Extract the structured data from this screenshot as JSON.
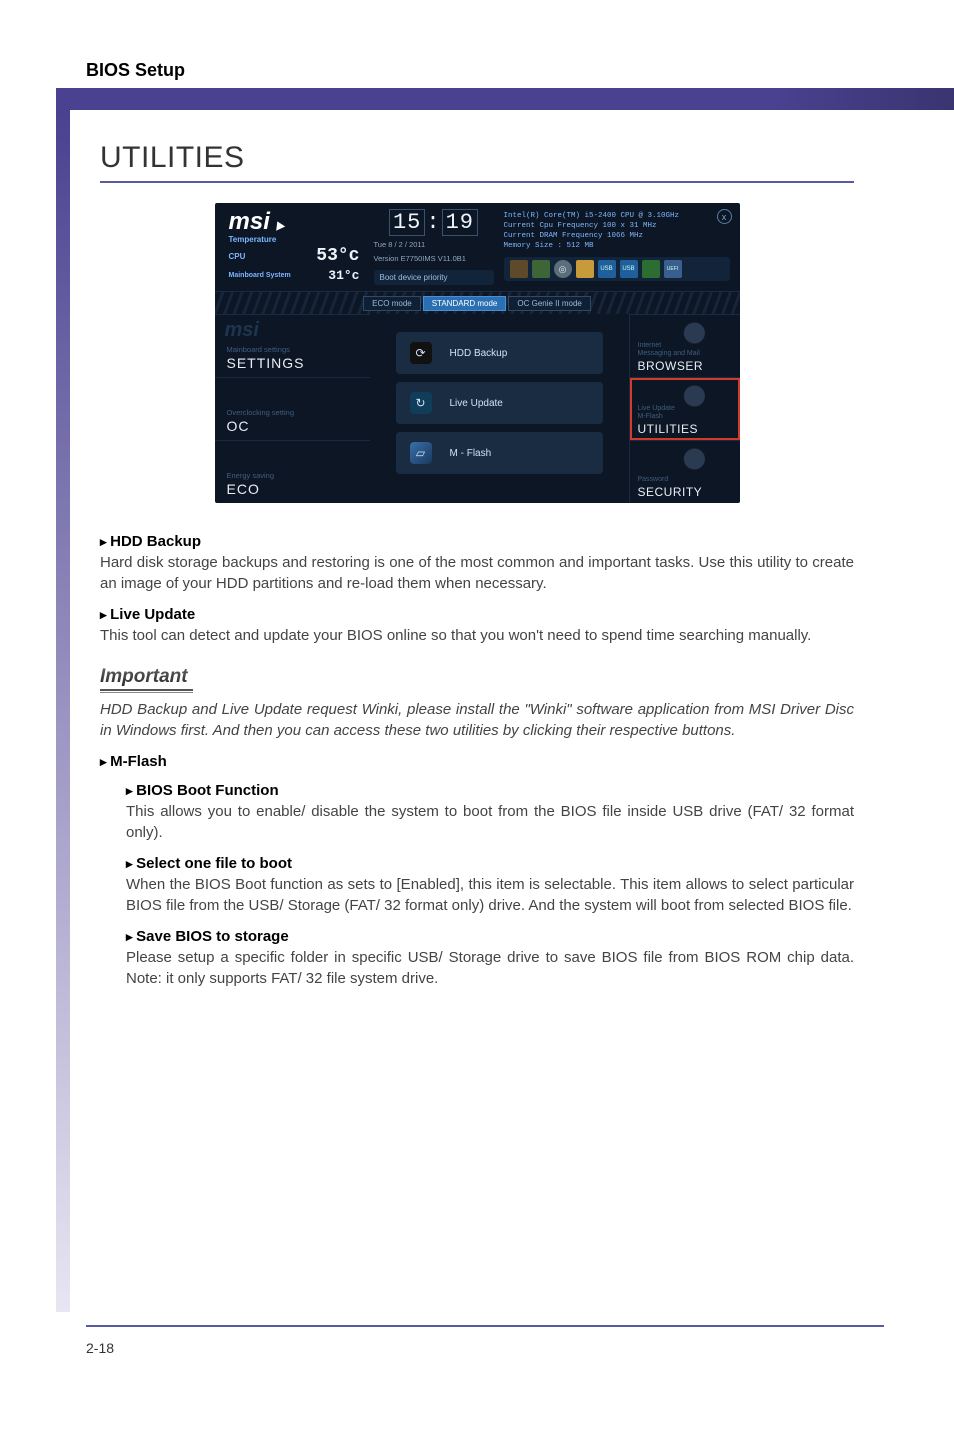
{
  "header": {
    "section_title": "BIOS Setup"
  },
  "page_title": "UTILITIES",
  "screenshot": {
    "brand": "msi",
    "temperature_label": "Temperature",
    "cpu_label": "CPU",
    "cpu_temp": "53°c",
    "mb_label": "Mainboard System",
    "mb_temp": "31°c",
    "clock": {
      "hh": "15",
      "mm": "19"
    },
    "date_line": "Tue  8 / 2 / 2011",
    "version_line": "Version E7750IMS V11.0B1",
    "boot_label": "Boot device priority",
    "cpu_info_1": "Intel(R) Core(TM) i5-2400 CPU @ 3.10GHz",
    "cpu_info_2": "Current Cpu Frequency 100 x 31 MHz",
    "cpu_info_3": "Current DRAM Frequency 1066 MHz",
    "cpu_info_4": "Memory Size : 512 MB",
    "modes": {
      "eco": "ECO\nmode",
      "standard": "STANDARD\nmode",
      "ocgenie": "OC Genie II\nmode"
    },
    "left_tiles": [
      {
        "ghost": "msi",
        "sub": "Mainboard settings",
        "main": "SETTINGS"
      },
      {
        "ghost": "",
        "sub": "Overclocking setting",
        "main": "OC"
      },
      {
        "ghost": "",
        "sub": "Energy saving",
        "main": "ECO"
      }
    ],
    "center_items": [
      {
        "label": "HDD Backup"
      },
      {
        "label": "Live Update"
      },
      {
        "label": "M - Flash"
      }
    ],
    "right_tiles": [
      {
        "sub": "Internet\nMessaging and Mail",
        "main": "BROWSER",
        "highlight": false
      },
      {
        "sub": "Live Update\nM-Flash",
        "main": "UTILITIES",
        "highlight": true
      },
      {
        "sub": "Password",
        "main": "SECURITY",
        "highlight": false
      }
    ]
  },
  "sections": {
    "hdd_backup": {
      "title": "HDD Backup",
      "text": "Hard disk storage backups and restoring is one of the most common and important tasks. Use this utility to create an image of your HDD partitions and re-load them when necessary."
    },
    "live_update": {
      "title": "Live Update",
      "text": "This tool can detect and update your BIOS online so that you won't need to spend time searching manually."
    },
    "important": {
      "label": "Important",
      "text": "HDD Backup and Live Update request Winki, please install the \"Winki\" software application from MSI Driver Disc in Windows first. And then you can access these two utilities by clicking their respective buttons."
    },
    "mflash": {
      "title": "M-Flash",
      "bios_boot": {
        "title": "BIOS Boot Function",
        "text": "This allows you to enable/ disable the system to boot from the BIOS file inside USB drive (FAT/ 32 format only)."
      },
      "select_one": {
        "title": "Select one file to boot",
        "text": "When the BIOS Boot function as sets to [Enabled], this item is selectable. This item allows to select particular BIOS file from the USB/ Storage (FAT/ 32 format only) drive. And the system will boot from selected BIOS file."
      },
      "save_bios": {
        "title": "Save BIOS to storage",
        "text": "Please setup a specific folder in specific USB/ Storage drive to save BIOS file from BIOS ROM chip data. Note: it only supports FAT/ 32 file system drive."
      }
    }
  },
  "page_number": "2-18"
}
